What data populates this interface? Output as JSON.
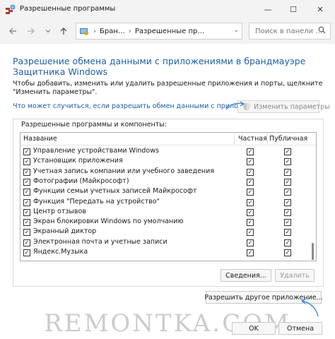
{
  "window": {
    "title": "Разрешенные программы",
    "controls": {
      "minimize": "—",
      "maximize": "☐",
      "close": "✕"
    }
  },
  "nav": {
    "back_icon": "arrow-left",
    "forward_icon": "arrow-right",
    "recent_icon": "chevron-down",
    "up_icon": "arrow-up"
  },
  "address": {
    "crumb1": "Бран…",
    "separator": "›",
    "crumb2": "Разрешенные пр…",
    "dropdown": "⌄"
  },
  "search": {
    "placeholder": "Поиск в панели …"
  },
  "content": {
    "heading": "Разрешение обмена данными с приложениями в брандмауэре Защитника Windows",
    "description": "Чтобы добавить, изменить или удалить разрешенные приложения и порты, щелкните \"Изменить параметры\".",
    "risk_link": "Что может случиться, если разрешить обмен данными с приложением?",
    "change_settings": "Изменить параметры"
  },
  "group": {
    "label": "Разрешенные программы и компоненты:",
    "columns": {
      "name": "Название",
      "private": "Частная",
      "public": "Публичная"
    },
    "items": [
      {
        "name": "Управление устройствами Windows",
        "enabled": true,
        "private": true,
        "public": true
      },
      {
        "name": "Установщик приложения",
        "enabled": true,
        "private": true,
        "public": true
      },
      {
        "name": "Учетная запись компании или учебного заведения",
        "enabled": true,
        "private": true,
        "public": true
      },
      {
        "name": "Фотографии (Майкрософт)",
        "enabled": true,
        "private": true,
        "public": true
      },
      {
        "name": "Функции семьи учетных записей Майкрософт",
        "enabled": true,
        "private": true,
        "public": true
      },
      {
        "name": "Функция \"Передать на устройство\"",
        "enabled": true,
        "private": true,
        "public": true
      },
      {
        "name": "Центр отзывов",
        "enabled": true,
        "private": true,
        "public": true
      },
      {
        "name": "Экран блокировки Windows по умолчанию",
        "enabled": true,
        "private": true,
        "public": true
      },
      {
        "name": "Экранный диктор",
        "enabled": true,
        "private": true,
        "public": true
      },
      {
        "name": "Электронная почта и учетные записи",
        "enabled": true,
        "private": true,
        "public": true
      },
      {
        "name": "Яндекс.Музыка",
        "enabled": true,
        "private": true,
        "public": true
      }
    ],
    "details_button": "Сведения...",
    "delete_button": "Удалить"
  },
  "buttons": {
    "allow_other": "Разрешить другое приложение...",
    "ok": "OK",
    "cancel": "Отмена"
  },
  "watermark": "REMONTKA.COM",
  "colors": {
    "accent": "#1f5fa8",
    "annotation": "#2b7fd8"
  }
}
